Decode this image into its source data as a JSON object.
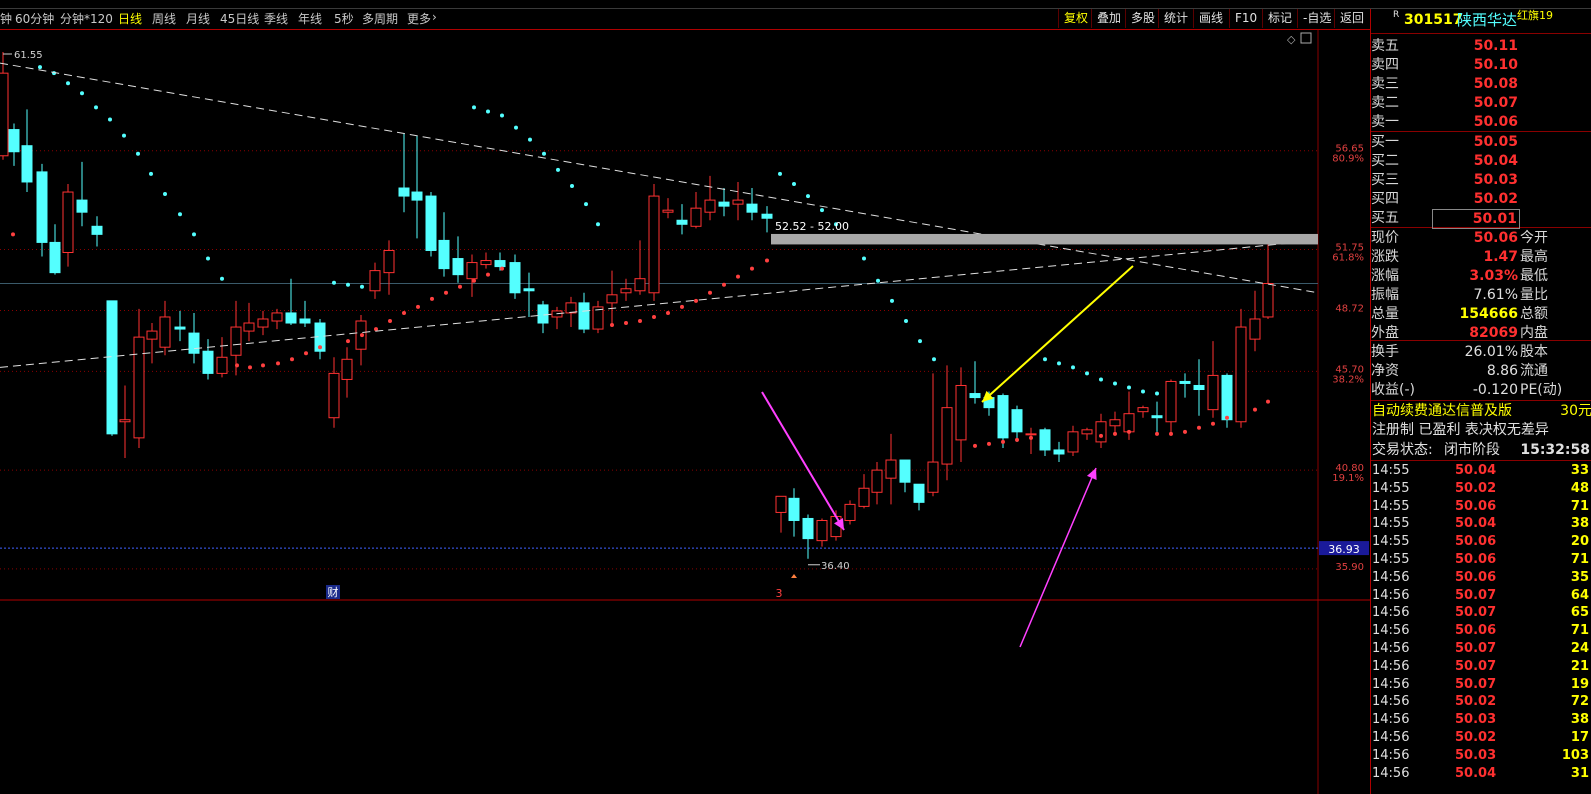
{
  "toolbar": {
    "periods": [
      "钟",
      "60分钟",
      "分钟*120",
      "日线",
      "周线",
      "月线",
      "45日线",
      "季线",
      "年线",
      "5秒",
      "多周期",
      "更多"
    ],
    "active_period": "日线",
    "right_buttons": [
      "复权",
      "叠加",
      "多股",
      "统计",
      "画线",
      "F10",
      "标记",
      "-自选",
      "返回"
    ]
  },
  "chart": {
    "high_mark": "61.55",
    "low_mark": "36.40",
    "zone_label": "52.52 - 52.00",
    "price_labels": [
      {
        "price": "56.65",
        "pct": "80.9%"
      },
      {
        "price": "51.75",
        "pct": "61.8%"
      },
      {
        "price": "48.72",
        "pct": ""
      },
      {
        "price": "45.70",
        "pct": "38.2%"
      },
      {
        "price": "40.80",
        "pct": "19.1%"
      },
      {
        "price": "35.90",
        "pct": ""
      }
    ],
    "cursor_price": "36.93",
    "event_marker": "财",
    "low_marker": "3",
    "colors": {
      "up": "#ff3232",
      "down": "#54ffff",
      "dots_red": "#ff4040",
      "dots_cyan": "#54ffff",
      "grid": "#8a0000"
    }
  },
  "panel": {
    "code": "301517",
    "name": "陕西华达",
    "badge": "R",
    "flag": "红旗19",
    "asks": [
      {
        "label": "卖五",
        "price": "50.11"
      },
      {
        "label": "卖四",
        "price": "50.10"
      },
      {
        "label": "卖三",
        "price": "50.08"
      },
      {
        "label": "卖二",
        "price": "50.07"
      },
      {
        "label": "卖一",
        "price": "50.06"
      }
    ],
    "bids": [
      {
        "label": "买一",
        "price": "50.05"
      },
      {
        "label": "买二",
        "price": "50.04"
      },
      {
        "label": "买三",
        "price": "50.03"
      },
      {
        "label": "买四",
        "price": "50.02"
      },
      {
        "label": "买五",
        "price": "50.01"
      }
    ],
    "quote": [
      {
        "label": "现价",
        "value": "50.06",
        "label2": "今开",
        "color": "r"
      },
      {
        "label": "涨跌",
        "value": "1.47",
        "label2": "最高",
        "color": "r"
      },
      {
        "label": "涨幅",
        "value": "3.03%",
        "label2": "最低",
        "color": "r"
      },
      {
        "label": "振幅",
        "value": "7.61%",
        "label2": "量比",
        "color": "w"
      },
      {
        "label": "总量",
        "value": "154666",
        "label2": "总额",
        "color": "y"
      },
      {
        "label": "外盘",
        "value": "82069",
        "label2": "内盘",
        "color": "r"
      }
    ],
    "fin": [
      {
        "label": "换手",
        "value": "26.01%",
        "label2": "股本"
      },
      {
        "label": "净资",
        "value": "8.86",
        "label2": "流通"
      },
      {
        "label": "收益(-)",
        "value": "-0.120",
        "label2": "PE(动)"
      }
    ],
    "promo": "自动续费通达信普及版",
    "promo_price": "30元",
    "tags": "注册制 已盈利 表决权无差异",
    "status_label": "交易状态:",
    "status_value": "闭市阶段",
    "status_time": "15:32:58",
    "trades": [
      {
        "time": "14:55",
        "price": "50.04",
        "vol": "33"
      },
      {
        "time": "14:55",
        "price": "50.02",
        "vol": "48"
      },
      {
        "time": "14:55",
        "price": "50.06",
        "vol": "71"
      },
      {
        "time": "14:55",
        "price": "50.04",
        "vol": "38"
      },
      {
        "time": "14:55",
        "price": "50.06",
        "vol": "20"
      },
      {
        "time": "14:55",
        "price": "50.06",
        "vol": "71"
      },
      {
        "time": "14:56",
        "price": "50.06",
        "vol": "35"
      },
      {
        "time": "14:56",
        "price": "50.07",
        "vol": "64"
      },
      {
        "time": "14:56",
        "price": "50.07",
        "vol": "65"
      },
      {
        "time": "14:56",
        "price": "50.06",
        "vol": "71"
      },
      {
        "time": "14:56",
        "price": "50.07",
        "vol": "24"
      },
      {
        "time": "14:56",
        "price": "50.07",
        "vol": "21"
      },
      {
        "time": "14:56",
        "price": "50.07",
        "vol": "19"
      },
      {
        "time": "14:56",
        "price": "50.02",
        "vol": "72"
      },
      {
        "time": "14:56",
        "price": "50.03",
        "vol": "38"
      },
      {
        "time": "14:56",
        "price": "50.02",
        "vol": "17"
      },
      {
        "time": "14:56",
        "price": "50.03",
        "vol": "103"
      },
      {
        "time": "14:56",
        "price": "50.04",
        "vol": "31"
      }
    ]
  }
}
